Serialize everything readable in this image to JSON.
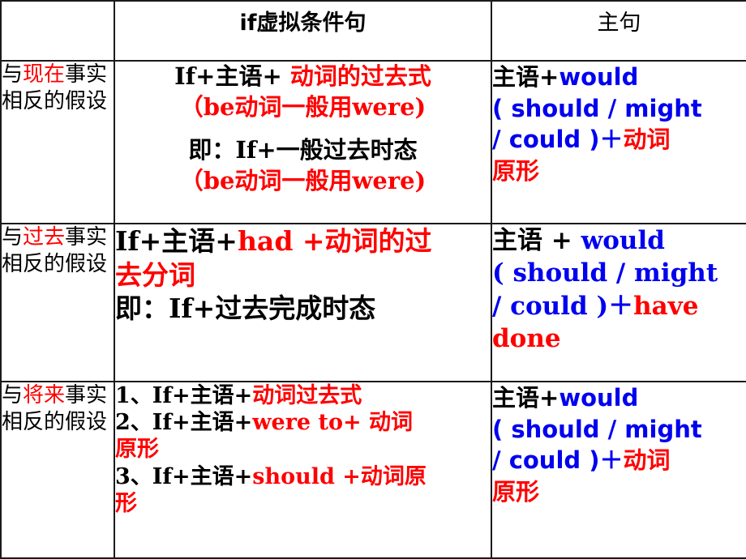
{
  "table": {
    "headers": {
      "category": "",
      "if_clause": "if虚拟条件句",
      "main_clause": "主句"
    },
    "rows": [
      {
        "id": "present",
        "category": {
          "prefix": "与",
          "highlight": "现在",
          "suffix": "事实相反的假设"
        },
        "if_clause": {
          "l1_black": "If+主语+ ",
          "l1_red": "动词的过去式",
          "l2_red": "（be动词一般用were)",
          "l3_black": "即：If+一般过去时态",
          "l4_red": "（be动词一般用were)"
        },
        "main_clause": {
          "l1_black": "主语+",
          "l1_blue": "would",
          "l2_blue": "( should / might",
          "l3_blue": "/ could )",
          "l3_plus": "＋",
          "l3_red": "动词",
          "l4_red": "原形"
        }
      },
      {
        "id": "past",
        "category": {
          "prefix": "与",
          "highlight": "过去",
          "suffix": "事实相反的假设"
        },
        "if_clause": {
          "l1_black": "If+主语+",
          "l1_red": "had +动词的过",
          "l2_red": "去分词",
          "l3_black": "即：If+过去完成时态"
        },
        "main_clause": {
          "l1_black": "主语 + ",
          "l1_blue": "would",
          "l2_blue": "( should / might",
          "l3_blue": "/ could )",
          "l3_plus": "＋",
          "l3_red": "have",
          "l4_red": "done"
        }
      },
      {
        "id": "future",
        "category": {
          "prefix": "与",
          "highlight": "将来",
          "suffix": "事实相反的假设"
        },
        "if_clause": {
          "n1_black": "1、If+主语+",
          "n1_red": "动词过去式",
          "n2_black": "2、If+主语+",
          "n2_red": "were to+ 动词",
          "n2_red_cont": "原形",
          "n3_black": "3、If+主语+",
          "n3_red": "should +动词原",
          "n3_red_cont": "形"
        },
        "main_clause": {
          "l1_black": "主语+",
          "l1_blue": "would",
          "l2_blue": "( should / might",
          "l3_blue": "/ could )",
          "l3_plus": "＋",
          "l3_red": "动词",
          "l4_red": "原形"
        }
      }
    ]
  },
  "colors": {
    "text_black": "#000000",
    "accent_red": "#ff0000",
    "accent_blue": "#0000f0",
    "border": "#1a1a1a",
    "background": "#ffffff"
  }
}
